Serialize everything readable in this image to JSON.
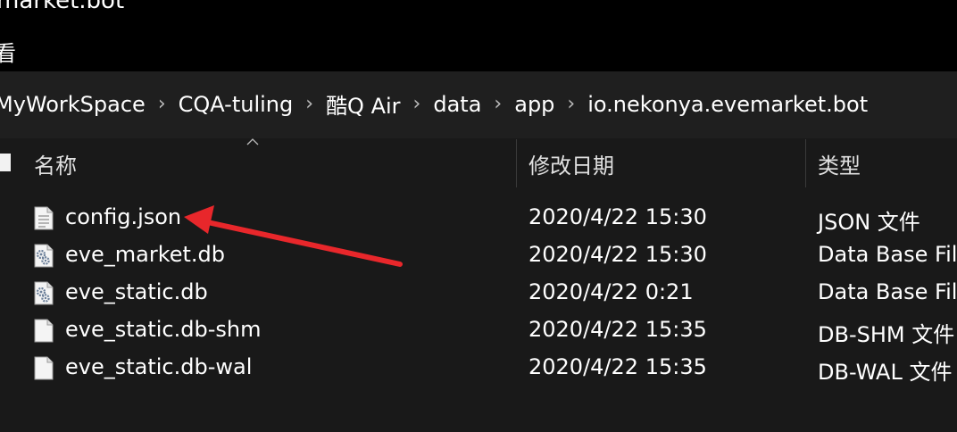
{
  "window": {
    "title": "market.bot",
    "menu_label": "看"
  },
  "address": {
    "breadcrumbs": [
      "MyWorkSpace",
      "CQA-tuling",
      "酷Q Air",
      "data",
      "app",
      "io.nekonya.evemarket.bot"
    ],
    "separator": "›"
  },
  "columns": {
    "name": "名称",
    "modified": "修改日期",
    "type": "类型"
  },
  "files": [
    {
      "name": "config.json",
      "modified": "2020/4/22 15:30",
      "type": "JSON 文件",
      "icon": "text-file-icon"
    },
    {
      "name": "eve_market.db",
      "modified": "2020/4/22 15:30",
      "type": "Data Base File",
      "icon": "gear-file-icon"
    },
    {
      "name": "eve_static.db",
      "modified": "2020/4/22 0:21",
      "type": "Data Base File",
      "icon": "gear-file-icon"
    },
    {
      "name": "eve_static.db-shm",
      "modified": "2020/4/22 15:35",
      "type": "DB-SHM 文件",
      "icon": "blank-file-icon"
    },
    {
      "name": "eve_static.db-wal",
      "modified": "2020/4/22 15:35",
      "type": "DB-WAL 文件",
      "icon": "blank-file-icon"
    }
  ],
  "colors": {
    "background": "#191919",
    "titlebar": "#000000",
    "annotation_arrow": "#e8272b"
  }
}
